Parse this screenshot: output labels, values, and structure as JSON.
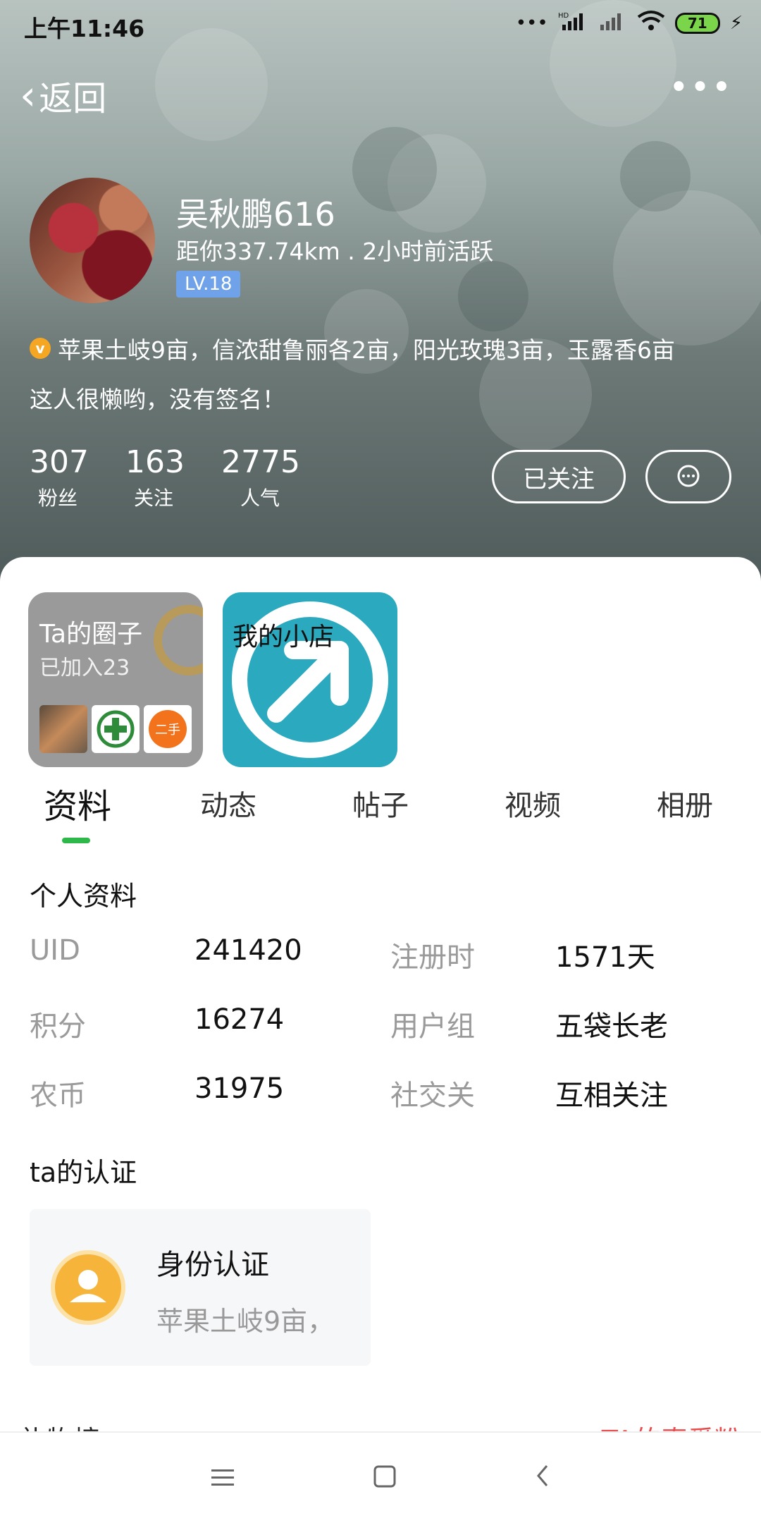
{
  "status_bar": {
    "time": "上午11:46",
    "battery": "71",
    "net": "HD"
  },
  "header": {
    "back_label": "返回",
    "more_label": "•••"
  },
  "profile": {
    "name": "吴秋鹏616",
    "distance_activity": "距你337.74km . 2小时前活跃",
    "level": "LV.18",
    "verified_bio": "苹果土岐9亩，信浓甜鲁丽各2亩，阳光玫瑰3亩，玉露香6亩",
    "signature": "这人很懒哟，没有签名！"
  },
  "stats": [
    {
      "value": "307",
      "label": "粉丝"
    },
    {
      "value": "163",
      "label": "关注"
    },
    {
      "value": "2775",
      "label": "人气"
    }
  ],
  "actions": {
    "follow_label": "已关注",
    "message_icon": "chat-bubble-icon"
  },
  "tiles": {
    "circle": {
      "title": "Ta的圈子",
      "subtitle": "已加入23",
      "thumb3_text": "二手"
    },
    "shop": {
      "title": "我的小店"
    }
  },
  "tabs": [
    "资料",
    "动态",
    "帖子",
    "视频",
    "相册"
  ],
  "active_tab": "资料",
  "personal_info": {
    "title": "个人资料",
    "rows": [
      {
        "k1": "UID",
        "v1": "241420",
        "k2": "注册时",
        "v2": "1571天"
      },
      {
        "k1": "积分",
        "v1": "16274",
        "k2": "用户组",
        "v2": "五袋长老"
      },
      {
        "k1": "农币",
        "v1": "31975",
        "k2": "社交关",
        "v2": "互相关注"
      }
    ]
  },
  "certification": {
    "title": "ta的认证",
    "card_title": "身份认证",
    "card_desc": "苹果土岐9亩，"
  },
  "peek": {
    "left": "礼物榜",
    "right": "TA的真爱粉"
  },
  "colors": {
    "accent_green": "#2eb84a",
    "level_blue": "#6fa2e8",
    "badge_orange": "#f5a623",
    "peek_red": "#e74b4b"
  }
}
